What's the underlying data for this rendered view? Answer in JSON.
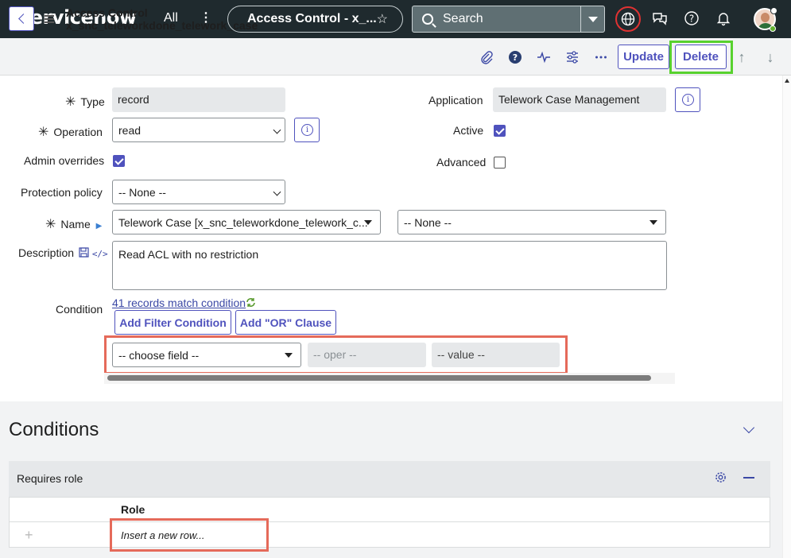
{
  "nav": {
    "logo": "servicenow",
    "all": "All",
    "kebab": "⋮",
    "tab_title": "Access Control - x_...",
    "search_label": "Search"
  },
  "header": {
    "title_line1": "Access Control",
    "title_line2": "x_snc_teleworkdone_telework_case",
    "update_label": "Update",
    "delete_label": "Delete"
  },
  "form": {
    "type_label": "Type",
    "type_value": "record",
    "application_label": "Application",
    "application_value": "Telework Case Management",
    "operation_label": "Operation",
    "operation_value": "read",
    "active_label": "Active",
    "active_checked": true,
    "admin_overrides_label": "Admin overrides",
    "admin_overrides_checked": true,
    "advanced_label": "Advanced",
    "advanced_checked": false,
    "protection_label": "Protection policy",
    "protection_value": "-- None --",
    "name_label": "Name",
    "name_value": "Telework Case [x_snc_teleworkdone_telework_c...",
    "name_field_value": "-- None --",
    "description_label": "Description",
    "description_value": "Read ACL with no restriction",
    "condition_label": "Condition",
    "condition_link": "41 records match condition",
    "add_filter_label": "Add Filter Condition",
    "add_or_label": "Add \"OR\" Clause",
    "choose_field": "-- choose field --",
    "oper": "-- oper --",
    "value": "-- value --"
  },
  "conditions": {
    "title": "Conditions",
    "related_list_title": "Requires role",
    "column_role": "Role",
    "insert_row": "Insert a new row..."
  },
  "colors": {
    "accent": "#4f52bd",
    "nav_bg": "#1f2a2e",
    "highlight_green": "#58d12e",
    "highlight_red": "#e56a5a"
  }
}
